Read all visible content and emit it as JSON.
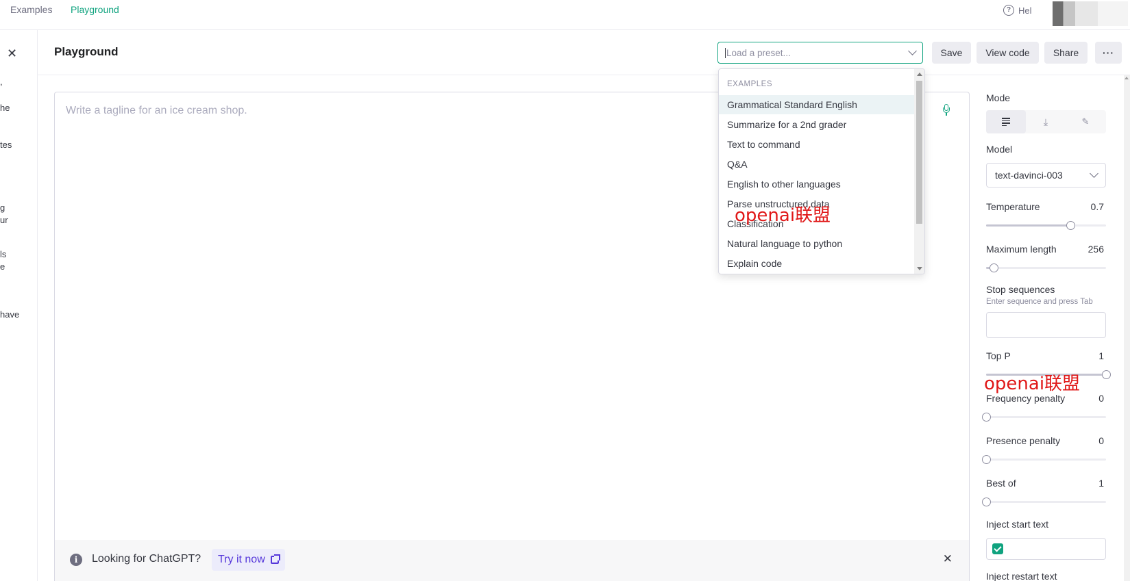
{
  "nav": {
    "examples": "Examples",
    "playground": "Playground",
    "help": "Hel"
  },
  "left_fragments": [
    ",",
    "he",
    "tes",
    "g",
    "ur",
    "ls",
    "e",
    "have"
  ],
  "header": {
    "title": "Playground",
    "preset_placeholder": "Load a preset...",
    "save": "Save",
    "view_code": "View code",
    "share": "Share",
    "more": "···"
  },
  "editor": {
    "placeholder": "Write a tagline for an ice cream shop."
  },
  "banner": {
    "text": "Looking for ChatGPT?",
    "cta": "Try it now"
  },
  "dropdown": {
    "section": "EXAMPLES",
    "items": [
      "Grammatical Standard English",
      "Summarize for a 2nd grader",
      "Text to command",
      "Q&A",
      "English to other languages",
      "Parse unstructured data",
      "Classification",
      "Natural language to python",
      "Explain code"
    ]
  },
  "settings": {
    "mode_label": "Mode",
    "model_label": "Model",
    "model_value": "text-davinci-003",
    "temperature": {
      "label": "Temperature",
      "value": "0.7",
      "level": 0.7
    },
    "max_length": {
      "label": "Maximum length",
      "value": "256",
      "level": 0.06
    },
    "stop": {
      "label": "Stop sequences",
      "hint": "Enter sequence and press Tab"
    },
    "top_p": {
      "label": "Top P",
      "value": "1",
      "level": 1.0
    },
    "freq": {
      "label": "Frequency penalty",
      "value": "0",
      "level": 0.0
    },
    "presence": {
      "label": "Presence penalty",
      "value": "0",
      "level": 0.0
    },
    "best_of": {
      "label": "Best of",
      "value": "1",
      "level": 0.0
    },
    "inject_start": "Inject start text",
    "inject_restart": "Inject restart text"
  },
  "watermark": "openai联盟",
  "colors": {
    "accent": "#10a37f",
    "link": "#5436da",
    "watermark": "#e01818"
  }
}
